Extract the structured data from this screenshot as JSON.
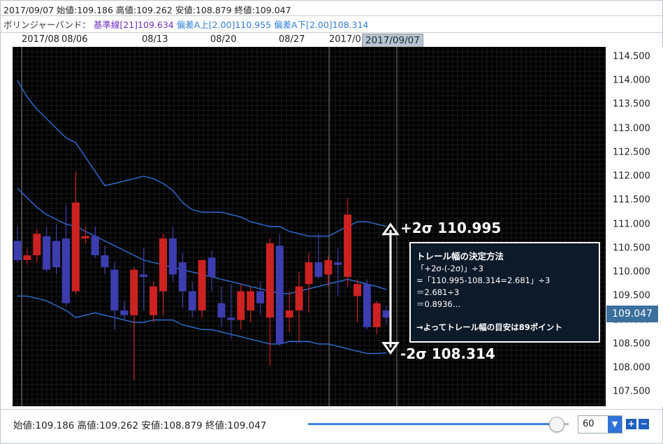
{
  "header": {
    "ohlc_line": "2017/09/07 始値:109.186 高値:109.262 安値:108.879 終値:109.047",
    "indicator_prefix": "ボリンジャーバンド：",
    "indicator_mid": "基準線[21]109.634",
    "indicator_upper": "偏差A上[2.00]110.955",
    "indicator_lower": "偏差A下[2.00]108.314"
  },
  "date_labels": [
    "2017/08",
    "08/06",
    "08/13",
    "08/20",
    "08/27",
    "2017/0"
  ],
  "current_date": "2017/09/07",
  "current_price": "109.047",
  "annotation": {
    "title": "トレール幅の決定方法",
    "lines": [
      "「+2σ-(-2σ)」÷3",
      "=「110.995-108.314=2.681」÷3",
      "＝2.681÷3",
      "＝0.8936…",
      "→よってトレール幅の目安は89ポイント"
    ],
    "upper_label": "+2σ 110.995",
    "lower_label": "-2σ 108.314"
  },
  "bottom": {
    "ohlc_line": "始値:109.186 高値:109.262 安値:108.879 終値:109.047",
    "period_value": "60",
    "plus": "+",
    "minus": "−"
  },
  "colors": {
    "background": "#000000",
    "bull": "#cc2222",
    "bear": "#3d3db0",
    "band": "#2a6fd6",
    "accent": "#2f73d8"
  },
  "chart_data": {
    "type": "candlestick",
    "y_ticks": [
      "114.500",
      "114.000",
      "113.500",
      "113.000",
      "112.500",
      "112.000",
      "111.500",
      "111.000",
      "110.500",
      "110.000",
      "109.500",
      "109.000",
      "108.500",
      "108.000",
      "107.500"
    ],
    "ylim": [
      107.2,
      114.7
    ],
    "candles": [
      {
        "o": 110.65,
        "h": 110.95,
        "l": 110.2,
        "c": 110.25
      },
      {
        "o": 110.25,
        "h": 110.5,
        "l": 110.15,
        "c": 110.35
      },
      {
        "o": 110.35,
        "h": 110.9,
        "l": 110.2,
        "c": 110.8
      },
      {
        "o": 110.75,
        "h": 110.95,
        "l": 110.0,
        "c": 110.05
      },
      {
        "o": 110.65,
        "h": 111.0,
        "l": 109.95,
        "c": 110.1
      },
      {
        "o": 110.7,
        "h": 111.4,
        "l": 109.3,
        "c": 109.35
      },
      {
        "o": 109.6,
        "h": 112.1,
        "l": 109.55,
        "c": 111.45
      },
      {
        "o": 110.7,
        "h": 110.95,
        "l": 110.6,
        "c": 110.75
      },
      {
        "o": 110.75,
        "h": 110.95,
        "l": 110.3,
        "c": 110.35
      },
      {
        "o": 110.35,
        "h": 110.55,
        "l": 109.95,
        "c": 110.1
      },
      {
        "o": 110.05,
        "h": 110.2,
        "l": 108.8,
        "c": 109.2
      },
      {
        "o": 109.2,
        "h": 109.4,
        "l": 109.0,
        "c": 109.1
      },
      {
        "o": 109.1,
        "h": 110.1,
        "l": 107.75,
        "c": 110.05
      },
      {
        "o": 109.95,
        "h": 110.5,
        "l": 109.2,
        "c": 109.9
      },
      {
        "o": 109.1,
        "h": 109.8,
        "l": 108.95,
        "c": 109.7
      },
      {
        "o": 109.6,
        "h": 110.8,
        "l": 109.1,
        "c": 110.7
      },
      {
        "o": 110.7,
        "h": 110.95,
        "l": 109.8,
        "c": 109.95
      },
      {
        "o": 110.2,
        "h": 110.4,
        "l": 109.25,
        "c": 109.6
      },
      {
        "o": 109.6,
        "h": 109.8,
        "l": 109.05,
        "c": 109.2
      },
      {
        "o": 109.2,
        "h": 110.25,
        "l": 109.05,
        "c": 110.25
      },
      {
        "o": 110.3,
        "h": 110.45,
        "l": 109.6,
        "c": 109.9
      },
      {
        "o": 109.35,
        "h": 109.7,
        "l": 108.85,
        "c": 109.05
      },
      {
        "o": 109.05,
        "h": 109.75,
        "l": 108.6,
        "c": 109.0
      },
      {
        "o": 109.0,
        "h": 109.75,
        "l": 108.8,
        "c": 109.6
      },
      {
        "o": 109.2,
        "h": 109.7,
        "l": 108.95,
        "c": 109.6
      },
      {
        "o": 109.6,
        "h": 109.8,
        "l": 109.1,
        "c": 109.35
      },
      {
        "o": 109.05,
        "h": 110.7,
        "l": 108.05,
        "c": 110.6
      },
      {
        "o": 110.55,
        "h": 110.8,
        "l": 108.45,
        "c": 108.5
      },
      {
        "o": 109.05,
        "h": 109.6,
        "l": 108.75,
        "c": 109.2
      },
      {
        "o": 109.2,
        "h": 110.0,
        "l": 108.55,
        "c": 109.7
      },
      {
        "o": 109.75,
        "h": 110.4,
        "l": 109.15,
        "c": 110.2
      },
      {
        "o": 110.2,
        "h": 110.8,
        "l": 109.85,
        "c": 109.9
      },
      {
        "o": 109.95,
        "h": 110.35,
        "l": 109.7,
        "c": 110.25
      },
      {
        "o": 110.2,
        "h": 110.5,
        "l": 109.5,
        "c": 110.15
      },
      {
        "o": 109.9,
        "h": 111.55,
        "l": 109.7,
        "c": 111.2
      },
      {
        "o": 109.5,
        "h": 109.85,
        "l": 108.95,
        "c": 109.75
      },
      {
        "o": 109.75,
        "h": 109.85,
        "l": 108.8,
        "c": 108.85
      },
      {
        "o": 108.85,
        "h": 109.4,
        "l": 108.7,
        "c": 109.35
      },
      {
        "o": 109.2,
        "h": 109.3,
        "l": 108.9,
        "c": 109.05
      }
    ],
    "upper_band": [
      114.0,
      113.65,
      113.4,
      113.2,
      113.0,
      112.8,
      112.7,
      112.4,
      112.1,
      111.8,
      111.85,
      111.9,
      111.95,
      112.0,
      111.95,
      111.85,
      111.7,
      111.45,
      111.3,
      111.25,
      111.25,
      111.25,
      111.2,
      111.15,
      111.05,
      111.0,
      110.95,
      110.95,
      110.85,
      110.8,
      110.75,
      110.75,
      110.75,
      110.85,
      110.95,
      111.05,
      111.05,
      111.0,
      110.955
    ],
    "middle_band": [
      111.75,
      111.55,
      111.35,
      111.2,
      111.1,
      111.0,
      110.95,
      110.85,
      110.75,
      110.65,
      110.55,
      110.45,
      110.35,
      110.25,
      110.2,
      110.15,
      110.1,
      110.05,
      110.0,
      109.95,
      109.9,
      109.85,
      109.8,
      109.75,
      109.7,
      109.65,
      109.6,
      109.55,
      109.55,
      109.6,
      109.65,
      109.7,
      109.75,
      109.8,
      109.85,
      109.8,
      109.75,
      109.7,
      109.634
    ],
    "lower_band": [
      109.5,
      109.5,
      109.45,
      109.4,
      109.3,
      109.2,
      109.05,
      109.1,
      109.15,
      109.1,
      109.05,
      109.0,
      108.95,
      108.95,
      109.0,
      109.0,
      109.0,
      108.9,
      108.85,
      108.8,
      108.8,
      108.75,
      108.7,
      108.65,
      108.6,
      108.55,
      108.5,
      108.5,
      108.55,
      108.55,
      108.55,
      108.5,
      108.5,
      108.45,
      108.4,
      108.35,
      108.3,
      108.3,
      108.314
    ]
  }
}
